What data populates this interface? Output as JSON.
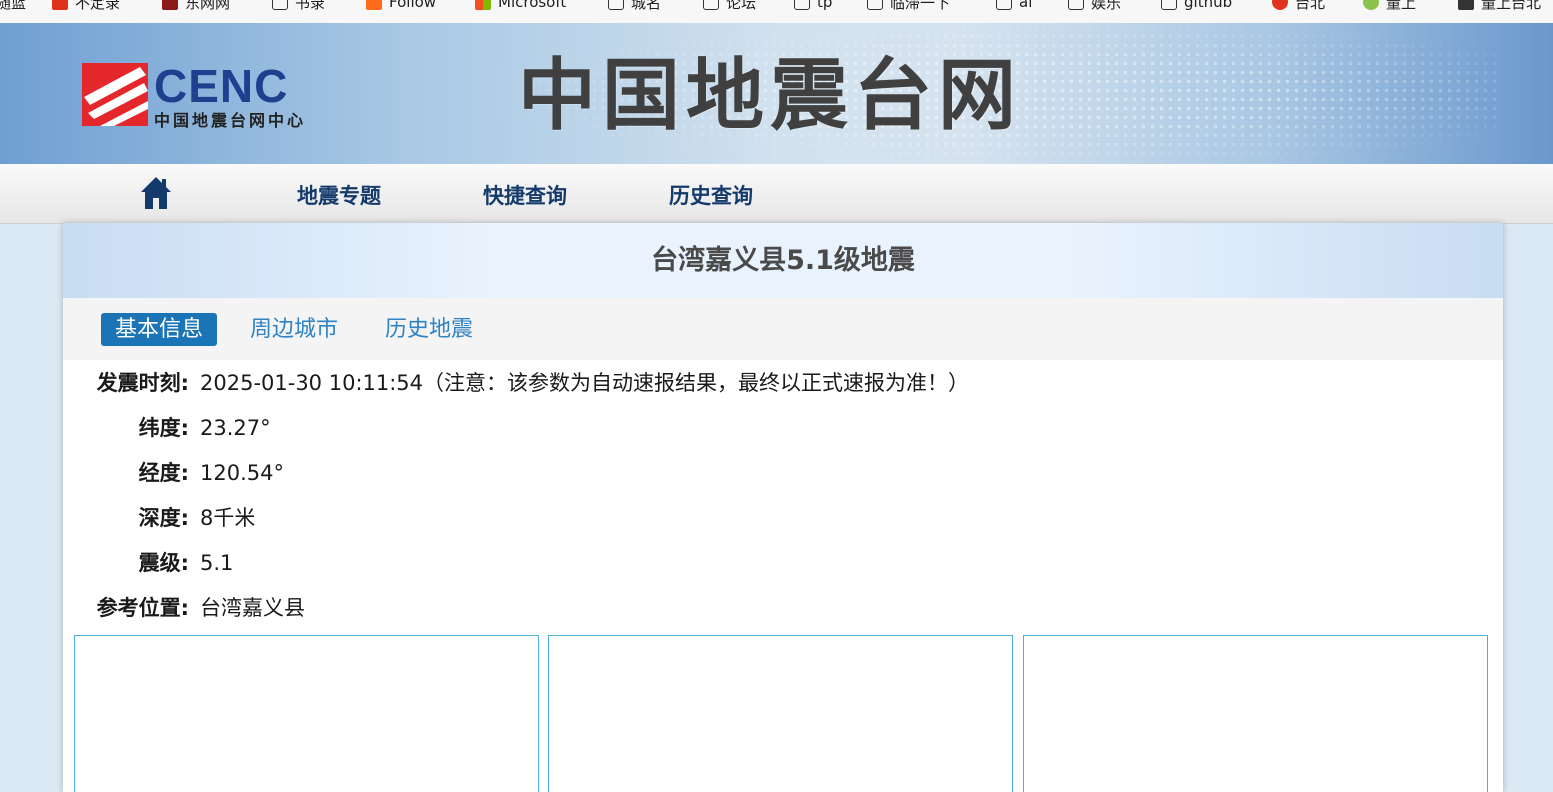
{
  "bookmarks": [
    {
      "label": "随蓝",
      "icon": "blank",
      "color": ""
    },
    {
      "label": "不定录",
      "icon": "app-icon",
      "color": "#e0301e"
    },
    {
      "label": "东网网",
      "icon": "app-icon",
      "color": "#8b1a1a"
    },
    {
      "label": "书录",
      "icon": "folder-icon",
      "color": ""
    },
    {
      "label": "Follow",
      "icon": "app-icon",
      "color": "#ff6b1a"
    },
    {
      "label": "Microsoft",
      "icon": "microsoft-icon",
      "color": ""
    },
    {
      "label": "城名",
      "icon": "folder-icon",
      "color": ""
    },
    {
      "label": "论坛",
      "icon": "folder-icon",
      "color": ""
    },
    {
      "label": "tp",
      "icon": "folder-icon",
      "color": ""
    },
    {
      "label": "临滞一下",
      "icon": "folder-icon",
      "color": ""
    },
    {
      "label": "ai",
      "icon": "folder-icon",
      "color": ""
    },
    {
      "label": "娱乐",
      "icon": "folder-icon",
      "color": ""
    },
    {
      "label": "github",
      "icon": "folder-icon",
      "color": ""
    },
    {
      "label": "台北",
      "icon": "app-icon",
      "color": "#e0301e"
    },
    {
      "label": "量上",
      "icon": "app-icon",
      "color": "#8bc34a"
    },
    {
      "label": "量上台北",
      "icon": "app-icon",
      "color": "#333333"
    }
  ],
  "header": {
    "logo_text": "CENC",
    "logo_subtext": "中国地震台网中心",
    "site_title": "中国地震台网",
    "colors": {
      "logo_red": "#e3272b",
      "logo_blue": "#1f3f8f"
    }
  },
  "nav": {
    "home_icon": "home-icon",
    "items": [
      "地震专题",
      "快捷查询",
      "历史查询"
    ],
    "color": "#143a6b"
  },
  "quake": {
    "title": "台湾嘉义县5.1级地震",
    "tabs": [
      {
        "label": "基本信息",
        "active": true
      },
      {
        "label": "周边城市",
        "active": false
      },
      {
        "label": "历史地震",
        "active": false
      }
    ],
    "details": [
      {
        "label": "发震时刻:",
        "value": "2025-01-30 10:11:54（注意：该参数为自动速报结果，最终以正式速报为准！）"
      },
      {
        "label": "纬度:",
        "value": "23.27°"
      },
      {
        "label": "经度:",
        "value": "120.54°"
      },
      {
        "label": "深度:",
        "value": "8千米"
      },
      {
        "label": "震级:",
        "value": "5.1"
      },
      {
        "label": "参考位置:",
        "value": "台湾嘉义县"
      }
    ],
    "active_tab_color": "#1b74b5",
    "tab_color": "#2f83c5"
  }
}
